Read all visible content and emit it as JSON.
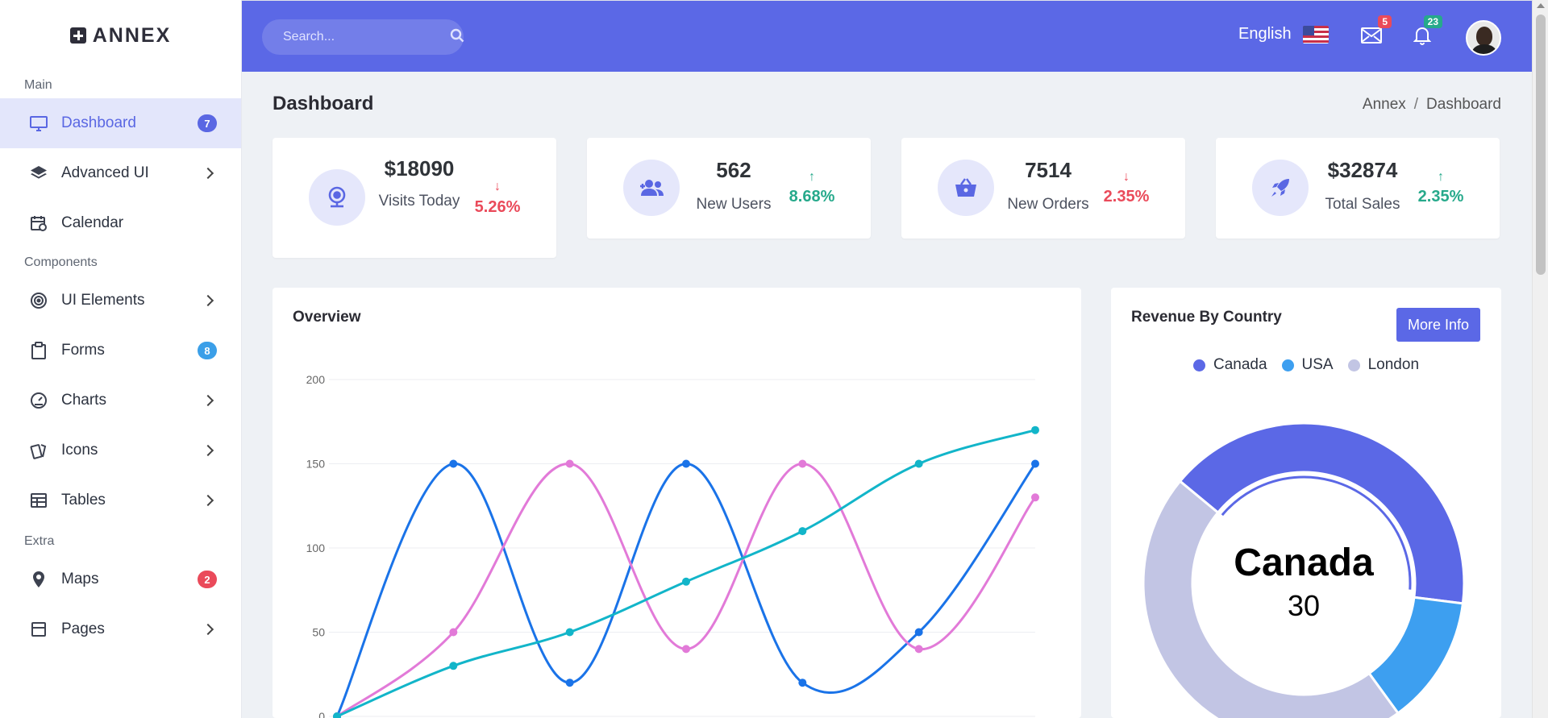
{
  "brand": {
    "name": "ANNEX"
  },
  "sidebar": {
    "sections": [
      "Main",
      "Components",
      "Extra"
    ],
    "items": [
      {
        "label": "Dashboard",
        "icon": "monitor-icon",
        "badge": "7",
        "badge_color": "#5a67e3",
        "active": true
      },
      {
        "label": "Advanced UI",
        "icon": "layers-icon",
        "chevron": true
      },
      {
        "label": "Calendar",
        "icon": "calendar-icon"
      },
      {
        "label": "UI Elements",
        "icon": "target-icon",
        "chevron": true
      },
      {
        "label": "Forms",
        "icon": "clipboard-icon",
        "badge": "8",
        "badge_color": "#3b9fe8"
      },
      {
        "label": "Charts",
        "icon": "gauge-icon",
        "chevron": true
      },
      {
        "label": "Icons",
        "icon": "cards-icon",
        "chevron": true
      },
      {
        "label": "Tables",
        "icon": "table-icon",
        "chevron": true
      },
      {
        "label": "Maps",
        "icon": "map-pin-icon",
        "badge": "2",
        "badge_color": "#ea4a5a"
      },
      {
        "label": "Pages",
        "icon": "pages-icon",
        "chevron": true
      }
    ]
  },
  "topbar": {
    "search_placeholder": "Search...",
    "language": "English",
    "mail_count": "5",
    "notification_count": "23",
    "colors": {
      "bar": "#5b68e6",
      "mail_badge": "#ea4a5a",
      "notif_badge": "#26a98b"
    }
  },
  "page": {
    "title": "Dashboard",
    "breadcrumb": [
      "Annex",
      "Dashboard"
    ]
  },
  "stats": [
    {
      "value": "$18090",
      "label": "Visits Today",
      "trend": "5.26%",
      "direction": "down",
      "icon": "webcam-icon"
    },
    {
      "value": "562",
      "label": "New Users",
      "trend": "8.68%",
      "direction": "up",
      "icon": "users-plus-icon"
    },
    {
      "value": "7514",
      "label": "New Orders",
      "trend": "2.35%",
      "direction": "down",
      "icon": "basket-icon"
    },
    {
      "value": "$32874",
      "label": "Total Sales",
      "trend": "2.35%",
      "direction": "up",
      "icon": "rocket-icon"
    }
  ],
  "overview": {
    "title": "Overview"
  },
  "revenue": {
    "title": "Revenue By Country",
    "button": "More Info",
    "center_label": "Canada",
    "center_value": "30"
  },
  "chart_data": [
    {
      "type": "line",
      "title": "Overview",
      "x": [
        0,
        1,
        2,
        3,
        4,
        5,
        6
      ],
      "ylim": [
        0,
        200
      ],
      "yticks": [
        0,
        50,
        100,
        150,
        200
      ],
      "grid": true,
      "series": [
        {
          "values": [
            0,
            150,
            20,
            150,
            20,
            50,
            150
          ],
          "color": "#1a73e8"
        },
        {
          "values": [
            0,
            50,
            150,
            40,
            150,
            40,
            130
          ],
          "color": "#e27ad8"
        },
        {
          "values": [
            0,
            30,
            50,
            80,
            110,
            150,
            170
          ],
          "color": "#12b5c9"
        }
      ]
    },
    {
      "type": "pie",
      "title": "Revenue By Country",
      "labels": [
        "Canada",
        "USA",
        "London"
      ],
      "values": [
        41,
        13,
        46
      ],
      "colors": [
        "#5b68e6",
        "#3d9ff0",
        "#c2c5e4"
      ],
      "legend": "top"
    }
  ]
}
